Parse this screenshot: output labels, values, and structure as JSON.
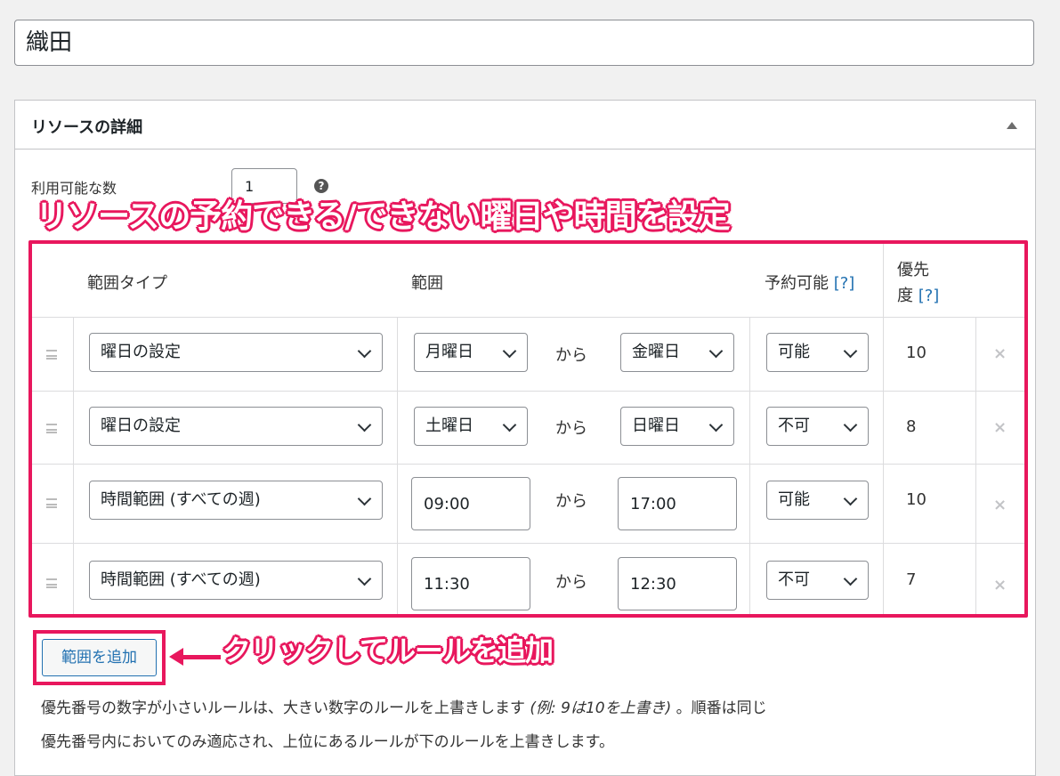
{
  "title_value": "織田",
  "postbox": {
    "title": "リソースの詳細"
  },
  "quantity": {
    "label": "利用可能な数",
    "value": "1",
    "help": "?"
  },
  "annotations": {
    "top": "リソースの予約できる/できない曜日や時間を設定",
    "bottom": "クリックしてルールを追加"
  },
  "table": {
    "headers": {
      "type": "範囲タイプ",
      "range": "範囲",
      "bookable": "予約可能",
      "bookable_help": "[?]",
      "priority_line1": "優先",
      "priority_line2": "度",
      "priority_help": "[?]"
    },
    "connector": "から",
    "remove_glyph": "×",
    "rows": [
      {
        "type": "曜日の設定",
        "from": "月曜日",
        "to": "金曜日",
        "bookable": "可能",
        "priority": "10"
      },
      {
        "type": "曜日の設定",
        "from": "土曜日",
        "to": "日曜日",
        "bookable": "不可",
        "priority": "8"
      },
      {
        "type": "時間範囲 (すべての週)",
        "from": "09:00",
        "to": "17:00",
        "bookable": "可能",
        "priority": "10"
      },
      {
        "type": "時間範囲 (すべての週)",
        "from": "11:30",
        "to": "12:30",
        "bookable": "不可",
        "priority": "7"
      }
    ]
  },
  "add_range_button": "範囲を追加",
  "note": {
    "line1_a": "優先番号の数字が小さいルールは、大きい数字のルールを上書きします ",
    "line1_ex": "(例: 9は10を上書き)",
    "line1_b": " 。順番は同じ",
    "line2": "優先番号内においてのみ適応され、上位にあるルールが下のルールを上書きします。"
  },
  "colors": {
    "annotation": "#e8175d",
    "link": "#2271b1"
  }
}
